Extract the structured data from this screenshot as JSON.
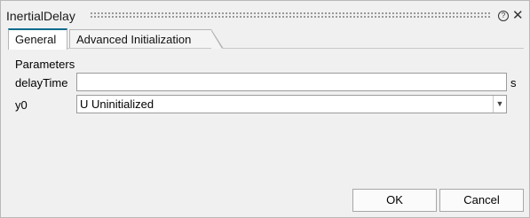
{
  "dialog": {
    "title": "InertialDelay"
  },
  "tabs": [
    {
      "label": "General",
      "active": true
    },
    {
      "label": "Advanced Initialization",
      "active": false
    }
  ],
  "parameters": {
    "section_label": "Parameters",
    "delayTime": {
      "label": "delayTime",
      "value": "",
      "unit": "s"
    },
    "y0": {
      "label": "y0",
      "selected": "U  Uninitialized"
    }
  },
  "buttons": {
    "ok": "OK",
    "cancel": "Cancel"
  },
  "icons": {
    "help": "help-icon",
    "close": "close-icon",
    "dropdown": "chevron-down-icon"
  },
  "colors": {
    "active_tab_accent": "#0b6a8c",
    "background": "#f0f0f0"
  }
}
